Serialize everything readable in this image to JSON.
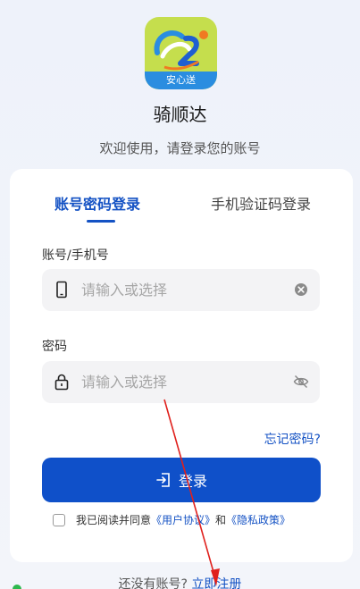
{
  "app": {
    "logo_text": "安心送",
    "name": "骑顺达",
    "welcome": "欢迎使用，请登录您的账号"
  },
  "tabs": [
    {
      "label": "账号密码登录",
      "active": true
    },
    {
      "label": "手机验证码登录",
      "active": false
    }
  ],
  "account": {
    "label": "账号/手机号",
    "placeholder": "请输入或选择",
    "value": ""
  },
  "password": {
    "label": "密码",
    "placeholder": "请输入或选择",
    "value": ""
  },
  "forgot_label": "忘记密码?",
  "login_button": {
    "label": "登录"
  },
  "agreement": {
    "prefix": "我已阅读并同意",
    "user_agreement": "《用户协议》",
    "and": "和",
    "privacy_policy": "《隐私政策》",
    "checked": false
  },
  "register": {
    "prompt": "还没有账号?",
    "link": "立即注册"
  },
  "colors": {
    "primary": "#0f50c9",
    "link": "#1452c4",
    "logo_bg": "#c5de4d",
    "logo_ribbon": "#2a8de0",
    "annotation_arrow": "#e0201c"
  }
}
